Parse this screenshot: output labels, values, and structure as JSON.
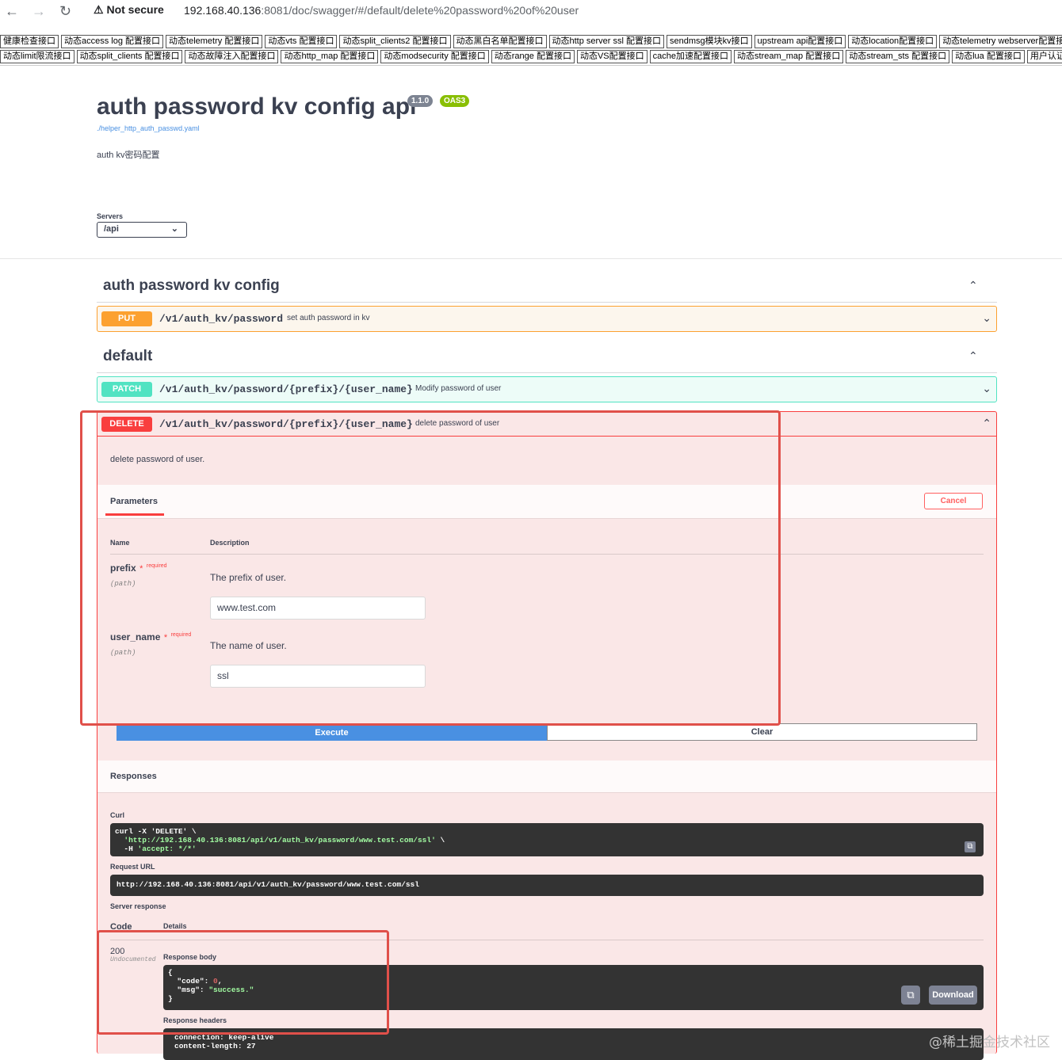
{
  "browser": {
    "security_label": "Not secure",
    "url_host": "192.168.40.136",
    "url_rest": ":8081/doc/swagger/#/default/delete%20password%20of%20user"
  },
  "bookmarks_row1": [
    "健康检查接口",
    "动态access log 配置接口",
    "动态telemetry 配置接口",
    "动态vts 配置接口",
    "动态split_clients2 配置接口",
    "动态黑白名单配置接口",
    "动态http server ssl 配置接口",
    "sendmsg模块kv接口",
    "upstream api配置接口",
    "动态location配置接口",
    "动态telemetry webserver配置接口"
  ],
  "bookmarks_row2": [
    "动态limit限流接口",
    "动态split_clients 配置接口",
    "动态故障注入配置接口",
    "动态http_map 配置接口",
    "动态modsecurity 配置接口",
    "动态range 配置接口",
    "动态VS配置接口",
    "cache加速配置接口",
    "动态stream_map 配置接口",
    "动态stream_sts 配置接口",
    "动态lua 配置接口",
    "用户认证密码配置接口"
  ],
  "info": {
    "title": "auth password kv config api",
    "version": "1.1.0",
    "oas": "OAS3",
    "spec_link": "./helper_http_auth_passwd.yaml",
    "description": "auth kv密码配置"
  },
  "servers": {
    "label": "Servers",
    "selected": "/api"
  },
  "tags": {
    "tag1": {
      "name": "auth password kv config",
      "op": {
        "method": "PUT",
        "path": "/v1/auth_kv/password",
        "summary": "set auth password in kv"
      }
    },
    "tag2": {
      "name": "default",
      "patch": {
        "method": "PATCH",
        "path": "/v1/auth_kv/password/{prefix}/{user_name}",
        "summary": "Modify password of user"
      },
      "delete": {
        "method": "DELETE",
        "path": "/v1/auth_kv/password/{prefix}/{user_name}",
        "summary": "delete password of user",
        "description": "delete password of user."
      }
    }
  },
  "params": {
    "tab_label": "Parameters",
    "cancel_label": "Cancel",
    "col_name": "Name",
    "col_desc": "Description",
    "required_text": "required",
    "required_mark": "*",
    "items": [
      {
        "name": "prefix",
        "in": "(path)",
        "description": "The prefix of user.",
        "value": "www.test.com"
      },
      {
        "name": "user_name",
        "in": "(path)",
        "description": "The name of user.",
        "value": "ssl"
      }
    ]
  },
  "actions": {
    "execute": "Execute",
    "clear": "Clear"
  },
  "responses": {
    "title": "Responses",
    "curl_label": "Curl",
    "curl_line1": "curl -X 'DELETE' \\",
    "curl_line2_url": "'http://192.168.40.136:8081/api/v1/auth_kv/password/www.test.com/ssl'",
    "curl_line2_tail": " \\",
    "curl_line3_h": "  -H ",
    "curl_line3_val": "'accept: */*'",
    "request_url_label": "Request URL",
    "request_url": "http://192.168.40.136:8081/api/v1/auth_kv/password/www.test.com/ssl",
    "server_response_label": "Server response",
    "code_header": "Code",
    "details_header": "Details",
    "code": "200",
    "undocumented": "Undocumented",
    "body_label": "Response body",
    "body": {
      "code_key": "\"code\"",
      "code_val": "0",
      "msg_key": "\"msg\"",
      "msg_val": "\"success.\""
    },
    "download_label": "Download",
    "headers_label": "Response headers",
    "headers": [
      "connection: keep-alive",
      "content-length: 27"
    ]
  },
  "watermark": "@稀土掘金技术社区",
  "colors": {
    "put": "#fca130",
    "patch": "#50e3c2",
    "delete": "#f93e3e",
    "execute": "#4990e2",
    "annotation": "#e0504a"
  }
}
